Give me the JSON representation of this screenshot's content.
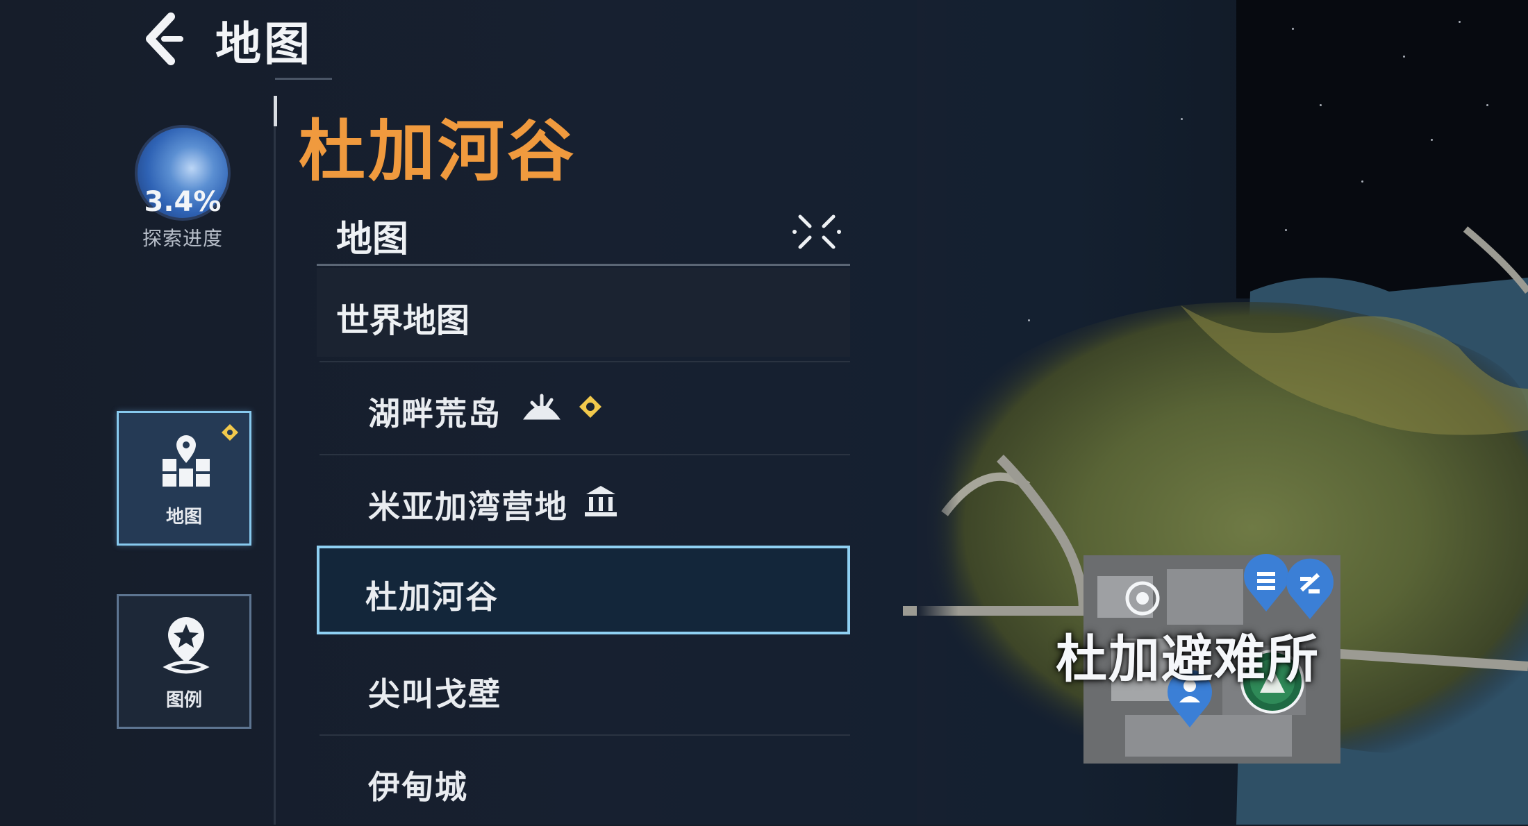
{
  "header": {
    "title": "地图",
    "back_icon": "back-arrow-icon"
  },
  "progress": {
    "percent_text": "3.4%",
    "label": "探索进度",
    "percent_value": 3.4
  },
  "sidebar": [
    {
      "label": "地图",
      "icon": "map-icon",
      "active": true
    },
    {
      "label": "图例",
      "icon": "legend-star-icon",
      "active": false
    }
  ],
  "region_title": "杜加河谷",
  "panel": {
    "header": "地图",
    "world_map": "世界地图",
    "items": [
      {
        "label": "湖畔荒岛",
        "icons": [
          "creature-icon",
          "waypoint-diamond-icon"
        ]
      },
      {
        "label": "米亚加湾营地",
        "icons": [
          "temple-icon"
        ]
      },
      {
        "label": "杜加河谷",
        "selected": true
      },
      {
        "label": "尖叫戈壁"
      },
      {
        "label": "伊甸城"
      }
    ]
  },
  "map": {
    "location_label": "杜加避难所",
    "markers": [
      "waypoint-ring-icon",
      "teleport-pin-icon",
      "shop-pin-icon",
      "npc-pin-icon",
      "faction-emblem-icon"
    ]
  },
  "colors": {
    "accent_orange": "#f09a3e",
    "selected_border": "#8fd0f2",
    "badge_yellow": "#f2c94c"
  }
}
